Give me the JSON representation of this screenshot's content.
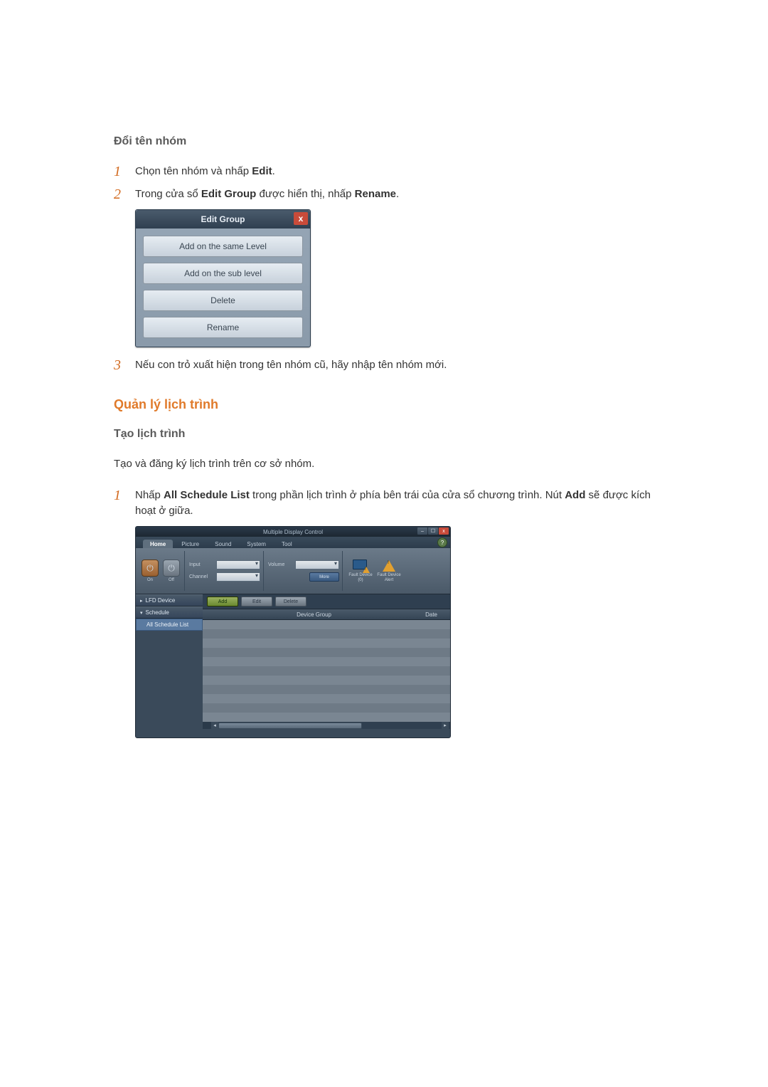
{
  "heading_rename": "Đổi tên nhóm",
  "step1": {
    "num": "1",
    "text_before": "Chọn tên nhóm và nhấp ",
    "bold": "Edit",
    "text_after": "."
  },
  "step2": {
    "num": "2",
    "t1": "Trong cửa sổ ",
    "b1": "Edit Group",
    "t2": " được hiển thị, nhấp ",
    "b2": "Rename",
    "t3": "."
  },
  "step3": {
    "num": "3",
    "text": "Nếu con trỏ xuất hiện trong tên nhóm cũ, hãy nhập tên nhóm mới."
  },
  "edit_group": {
    "title": "Edit Group",
    "close": "x",
    "buttons": [
      "Add on the same Level",
      "Add on the sub level",
      "Delete",
      "Rename"
    ]
  },
  "heading_schedule_mgmt": "Quản lý lịch trình",
  "heading_create_schedule": "Tạo lịch trình",
  "create_schedule_desc": "Tạo và đăng ký lịch trình trên cơ sở nhóm.",
  "sched_step1": {
    "num": "1",
    "t1": "Nhấp ",
    "b1": "All Schedule List",
    "t2": " trong phần lịch trình ở phía bên trái của cửa sổ chương trình. Nút ",
    "b2": "Add",
    "t3": " sẽ được kích hoạt ở giữa."
  },
  "mdc": {
    "title": "Multiple Display Control",
    "win_min": "–",
    "win_max": "☐",
    "win_close": "x",
    "help": "?",
    "tabs": {
      "home": "Home",
      "picture": "Picture",
      "sound": "Sound",
      "system": "System",
      "tool": "Tool"
    },
    "ribbon": {
      "on": "On",
      "off": "Off",
      "input": "Input",
      "channel": "Channel",
      "volume": "Volume",
      "more": "More",
      "fault_device": "Fault Device",
      "fault_count": "(0)",
      "fault_alert": "Fault Device Alert"
    },
    "side": {
      "lfd_device": "LFD Device",
      "schedule": "Schedule",
      "all_schedule_list": "All Schedule List"
    },
    "actionbar": {
      "add": "Add",
      "edit": "Edit",
      "delete": "Delete"
    },
    "table": {
      "device_group": "Device Group",
      "date": "Date"
    },
    "row_count": 11
  }
}
